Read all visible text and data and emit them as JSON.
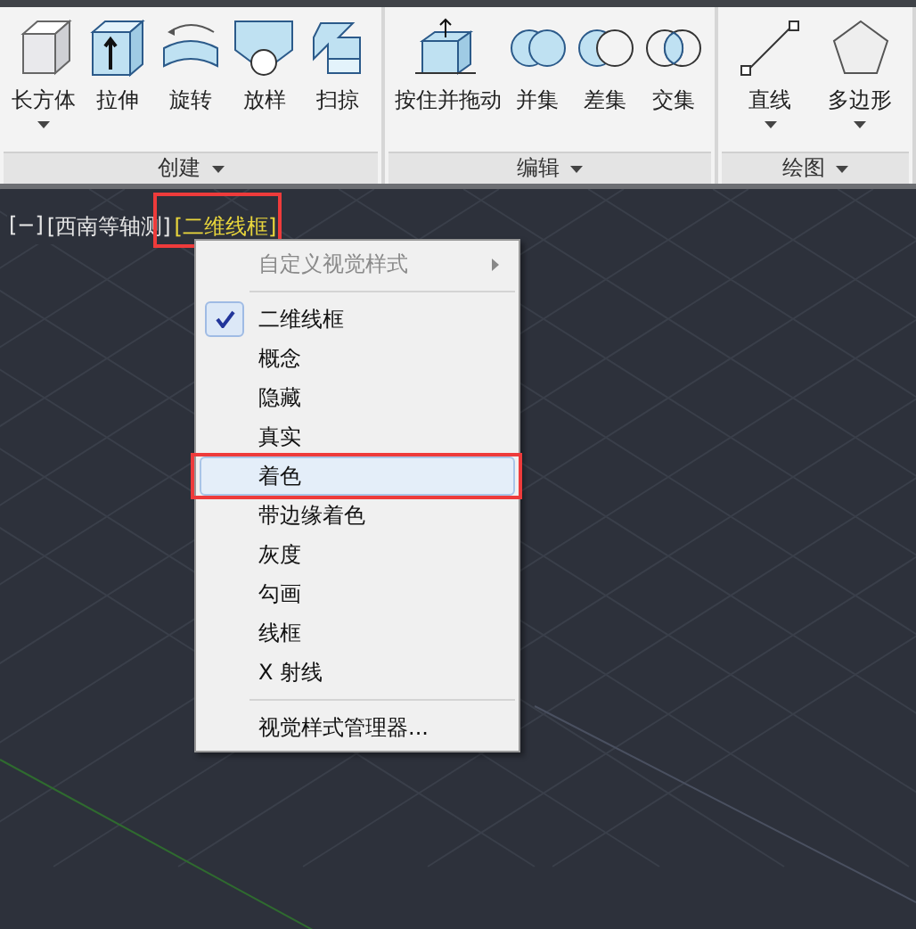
{
  "ribbon": {
    "panels": [
      {
        "title": "创建",
        "tools": [
          {
            "label": "长方体",
            "kind": "box",
            "dropdown": true
          },
          {
            "label": "拉伸",
            "kind": "extrude",
            "dropdown": false
          },
          {
            "label": "旋转",
            "kind": "revolve",
            "dropdown": false
          },
          {
            "label": "放样",
            "kind": "loft",
            "dropdown": false
          },
          {
            "label": "扫掠",
            "kind": "sweep",
            "dropdown": false
          }
        ]
      },
      {
        "title": "编辑",
        "tools": [
          {
            "label": "按住并拖动",
            "kind": "presspull",
            "dropdown": false
          },
          {
            "label": "并集",
            "kind": "union",
            "dropdown": false
          },
          {
            "label": "差集",
            "kind": "subtract",
            "dropdown": false
          },
          {
            "label": "交集",
            "kind": "intersect",
            "dropdown": false
          }
        ]
      },
      {
        "title": "绘图",
        "tools": [
          {
            "label": "直线",
            "kind": "line",
            "dropdown": true
          },
          {
            "label": "多边形",
            "kind": "polygon",
            "dropdown": true
          }
        ]
      }
    ]
  },
  "viewport": {
    "controls": [
      {
        "label": "[−]",
        "selected": false
      },
      {
        "label": "[西南等轴测]",
        "selected": false
      },
      {
        "label": "[二维线框]",
        "selected": true
      }
    ]
  },
  "menu": {
    "header": {
      "label": "自定义视觉样式",
      "disabled": true
    },
    "items": [
      {
        "label": "二维线框",
        "checked": true,
        "selected": false
      },
      {
        "label": "概念",
        "checked": false,
        "selected": false
      },
      {
        "label": "隐藏",
        "checked": false,
        "selected": false
      },
      {
        "label": "真实",
        "checked": false,
        "selected": false
      },
      {
        "label": "着色",
        "checked": false,
        "selected": true
      },
      {
        "label": "带边缘着色",
        "checked": false,
        "selected": false
      },
      {
        "label": "灰度",
        "checked": false,
        "selected": false
      },
      {
        "label": "勾画",
        "checked": false,
        "selected": false
      },
      {
        "label": "线框",
        "checked": false,
        "selected": false
      },
      {
        "label": "X 射线",
        "checked": false,
        "selected": false
      }
    ],
    "footer": "视觉样式管理器..."
  }
}
